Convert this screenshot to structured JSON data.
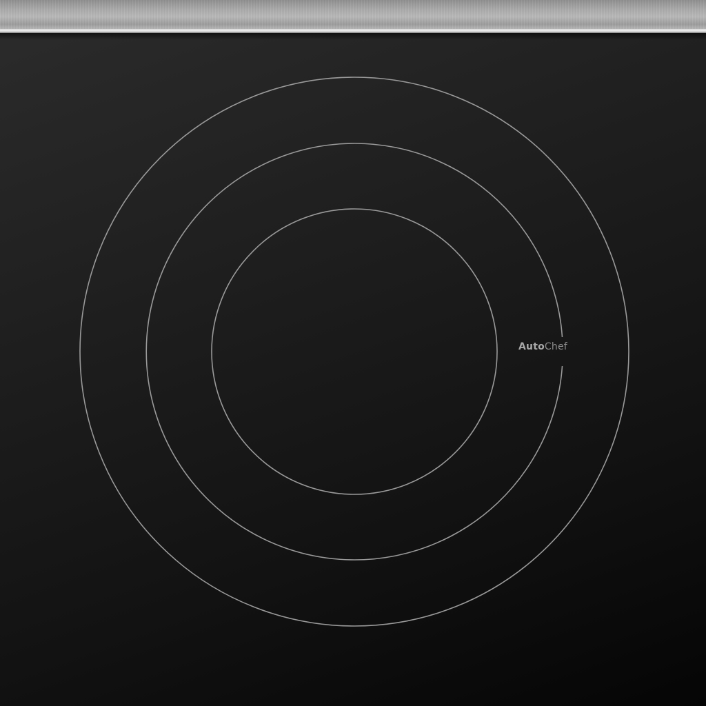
{
  "brand": {
    "part1": "Auto",
    "part2": "Chef"
  },
  "colors": {
    "glass": "#1a1a1a",
    "ring_line": "#9a9a9a",
    "steel_trim": "#b5b5b5",
    "brand_text": "#9c9c9c"
  },
  "cooktop": {
    "zone_rings": 3
  }
}
